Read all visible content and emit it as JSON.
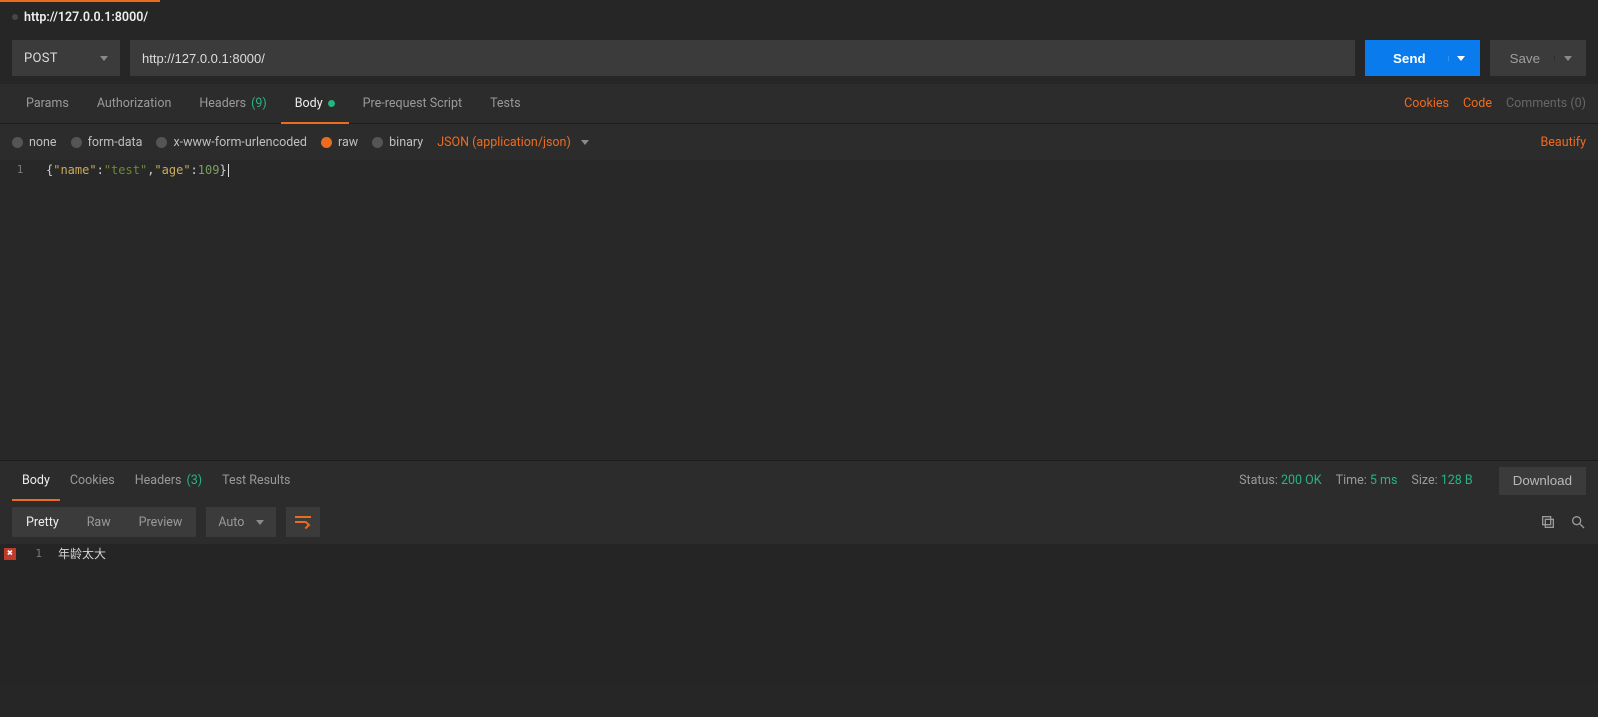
{
  "titleTab": "http://127.0.0.1:8000/",
  "request": {
    "method": "POST",
    "url": "http://127.0.0.1:8000/",
    "send": "Send",
    "save": "Save"
  },
  "reqTabs": {
    "params": "Params",
    "auth": "Authorization",
    "headers": "Headers",
    "headersCount": "(9)",
    "body": "Body",
    "prereq": "Pre-request Script",
    "tests": "Tests",
    "cookies": "Cookies",
    "code": "Code",
    "comments": "Comments (0)"
  },
  "bodyOpts": {
    "none": "none",
    "formdata": "form-data",
    "xwww": "x-www-form-urlencoded",
    "raw": "raw",
    "binary": "binary",
    "ctype": "JSON (application/json)",
    "beautify": "Beautify"
  },
  "reqBody": {
    "line": "1",
    "tokens": {
      "open": "{",
      "k1": "\"name\"",
      "c1": ":",
      "v1": "\"test\"",
      "comma": ",",
      "k2": "\"age\"",
      "c2": ":",
      "v2": "109",
      "close": "}"
    }
  },
  "respTabs": {
    "body": "Body",
    "cookies": "Cookies",
    "headers": "Headers",
    "headersCount": "(3)",
    "tests": "Test Results"
  },
  "respMeta": {
    "statusLbl": "Status:",
    "statusVal": "200 OK",
    "timeLbl": "Time:",
    "timeVal": "5 ms",
    "sizeLbl": "Size:",
    "sizeVal": "128 B",
    "download": "Download"
  },
  "viewBar": {
    "pretty": "Pretty",
    "rawv": "Raw",
    "preview": "Preview",
    "auto": "Auto"
  },
  "respBody": {
    "line": "1",
    "errMark": "✖",
    "text": "年龄太大"
  }
}
